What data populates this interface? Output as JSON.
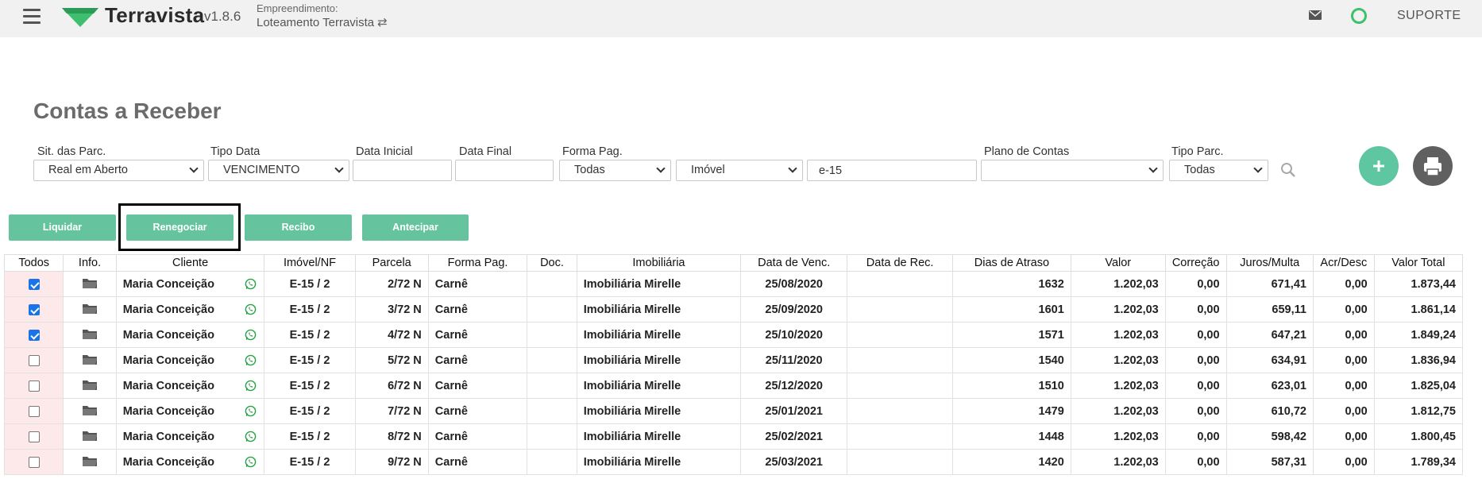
{
  "header": {
    "brand": "Terravista",
    "version": "v1.8.6",
    "empreendimento_label": "Empreendimento:",
    "empreendimento_value": "Loteamento Terravista",
    "support": "SUPORTE",
    "accent_color": "#3ec16b"
  },
  "page": {
    "title": "Contas a Receber"
  },
  "filters": {
    "sit_label": "Sit. das Parc.",
    "sit_value": "Real em Aberto",
    "tipo_data_label": "Tipo Data",
    "tipo_data_value": "VENCIMENTO",
    "data_inicial_label": "Data Inicial",
    "data_inicial_value": "",
    "data_final_label": "Data Final",
    "data_final_value": "",
    "forma_pag_label": "Forma Pag.",
    "forma_pag_value": "Todas",
    "imovel_value": "Imóvel",
    "search_value": "e-15",
    "plano_label": "Plano de Contas",
    "plano_value": "",
    "tipo_parc_label": "Tipo Parc.",
    "tipo_parc_value": "Todas"
  },
  "actions": {
    "liquidar": "Liquidar",
    "renegociar": "Renegociar",
    "recibo": "Recibo",
    "antecipar": "Antecipar"
  },
  "table": {
    "headers": [
      "Todos",
      "Info.",
      "Cliente",
      "Imóvel/NF",
      "Parcela",
      "Forma Pag.",
      "Doc.",
      "Imobiliária",
      "Data de Venc.",
      "Data de Rec.",
      "Dias de Atraso",
      "Valor",
      "Correção",
      "Juros/Multa",
      "Acr/Desc",
      "Valor Total"
    ],
    "rows": [
      {
        "checked": true,
        "cliente": "Maria Conceição",
        "imovel": "E-15 / 2",
        "parcela": "2/72 N",
        "forma": "Carnê",
        "doc": "",
        "imobiliaria": "Imobiliária Mirelle",
        "venc": "25/08/2020",
        "rec": "",
        "atraso": "1632",
        "valor": "1.202,03",
        "correcao": "0,00",
        "juros": "671,41",
        "acr": "0,00",
        "total": "1.873,44"
      },
      {
        "checked": true,
        "cliente": "Maria Conceição",
        "imovel": "E-15 / 2",
        "parcela": "3/72 N",
        "forma": "Carnê",
        "doc": "",
        "imobiliaria": "Imobiliária Mirelle",
        "venc": "25/09/2020",
        "rec": "",
        "atraso": "1601",
        "valor": "1.202,03",
        "correcao": "0,00",
        "juros": "659,11",
        "acr": "0,00",
        "total": "1.861,14"
      },
      {
        "checked": true,
        "cliente": "Maria Conceição",
        "imovel": "E-15 / 2",
        "parcela": "4/72 N",
        "forma": "Carnê",
        "doc": "",
        "imobiliaria": "Imobiliária Mirelle",
        "venc": "25/10/2020",
        "rec": "",
        "atraso": "1571",
        "valor": "1.202,03",
        "correcao": "0,00",
        "juros": "647,21",
        "acr": "0,00",
        "total": "1.849,24"
      },
      {
        "checked": false,
        "cliente": "Maria Conceição",
        "imovel": "E-15 / 2",
        "parcela": "5/72 N",
        "forma": "Carnê",
        "doc": "",
        "imobiliaria": "Imobiliária Mirelle",
        "venc": "25/11/2020",
        "rec": "",
        "atraso": "1540",
        "valor": "1.202,03",
        "correcao": "0,00",
        "juros": "634,91",
        "acr": "0,00",
        "total": "1.836,94"
      },
      {
        "checked": false,
        "cliente": "Maria Conceição",
        "imovel": "E-15 / 2",
        "parcela": "6/72 N",
        "forma": "Carnê",
        "doc": "",
        "imobiliaria": "Imobiliária Mirelle",
        "venc": "25/12/2020",
        "rec": "",
        "atraso": "1510",
        "valor": "1.202,03",
        "correcao": "0,00",
        "juros": "623,01",
        "acr": "0,00",
        "total": "1.825,04"
      },
      {
        "checked": false,
        "cliente": "Maria Conceição",
        "imovel": "E-15 / 2",
        "parcela": "7/72 N",
        "forma": "Carnê",
        "doc": "",
        "imobiliaria": "Imobiliária Mirelle",
        "venc": "25/01/2021",
        "rec": "",
        "atraso": "1479",
        "valor": "1.202,03",
        "correcao": "0,00",
        "juros": "610,72",
        "acr": "0,00",
        "total": "1.812,75"
      },
      {
        "checked": false,
        "cliente": "Maria Conceição",
        "imovel": "E-15 / 2",
        "parcela": "8/72 N",
        "forma": "Carnê",
        "doc": "",
        "imobiliaria": "Imobiliária Mirelle",
        "venc": "25/02/2021",
        "rec": "",
        "atraso": "1448",
        "valor": "1.202,03",
        "correcao": "0,00",
        "juros": "598,42",
        "acr": "0,00",
        "total": "1.800,45"
      },
      {
        "checked": false,
        "cliente": "Maria Conceição",
        "imovel": "E-15 / 2",
        "parcela": "9/72 N",
        "forma": "Carnê",
        "doc": "",
        "imobiliaria": "Imobiliária Mirelle",
        "venc": "25/03/2021",
        "rec": "",
        "atraso": "1420",
        "valor": "1.202,03",
        "correcao": "0,00",
        "juros": "587,31",
        "acr": "0,00",
        "total": "1.789,34"
      }
    ]
  }
}
